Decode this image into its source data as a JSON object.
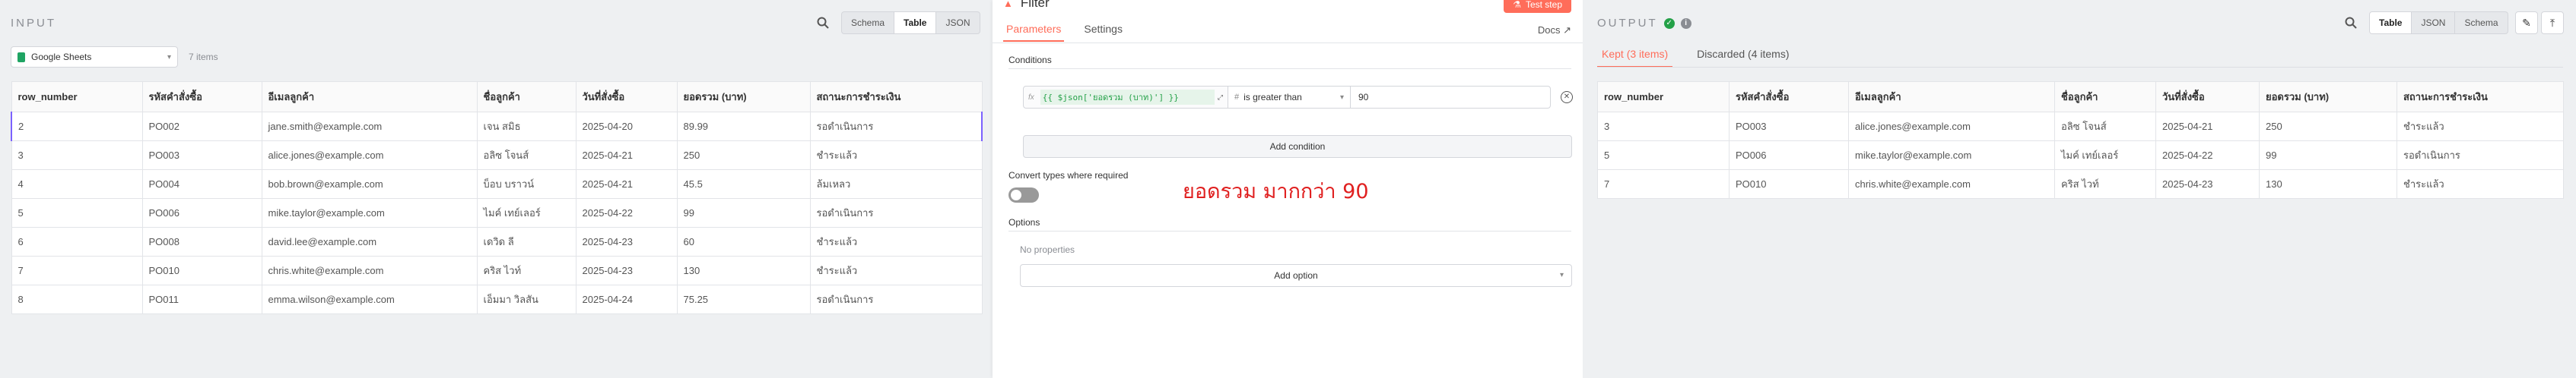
{
  "input": {
    "title": "INPUT",
    "view_options": [
      "Schema",
      "Table",
      "JSON"
    ],
    "active_view": "Table",
    "source": "Google Sheets",
    "item_count": "7 items",
    "columns": [
      "row_number",
      "รหัสคำสั่งซื้อ",
      "อีเมลลูกค้า",
      "ชื่อลูกค้า",
      "วันที่สั่งซื้อ",
      "ยอดรวม (บาท)",
      "สถานะการชำระเงิน"
    ],
    "rows": [
      [
        "2",
        "PO002",
        "jane.smith@example.com",
        "เจน สมิธ",
        "2025-04-20",
        "89.99",
        "รอดำเนินการ"
      ],
      [
        "3",
        "PO003",
        "alice.jones@example.com",
        "อลิซ โจนส์",
        "2025-04-21",
        "250",
        "ชำระแล้ว"
      ],
      [
        "4",
        "PO004",
        "bob.brown@example.com",
        "บ็อบ บราวน์",
        "2025-04-21",
        "45.5",
        "ล้มเหลว"
      ],
      [
        "5",
        "PO006",
        "mike.taylor@example.com",
        "ไมค์ เทย์เลอร์",
        "2025-04-22",
        "99",
        "รอดำเนินการ"
      ],
      [
        "6",
        "PO008",
        "david.lee@example.com",
        "เดวิด ลี",
        "2025-04-23",
        "60",
        "ชำระแล้ว"
      ],
      [
        "7",
        "PO010",
        "chris.white@example.com",
        "คริส ไวท์",
        "2025-04-23",
        "130",
        "ชำระแล้ว"
      ],
      [
        "8",
        "PO011",
        "emma.wilson@example.com",
        "เอ็มมา วิลสัน",
        "2025-04-24",
        "75.25",
        "รอดำเนินการ"
      ]
    ]
  },
  "node": {
    "title": "Filter",
    "test_step": "Test step",
    "tabs": [
      "Parameters",
      "Settings"
    ],
    "active_tab": "Parameters",
    "docs": "Docs",
    "conditions_label": "Conditions",
    "condition": {
      "left_expression": "{{ $json['ยอดรวม (บาท)'] }}",
      "operator": "is greater than",
      "value": "90"
    },
    "add_condition": "Add condition",
    "convert_label": "Convert types where required",
    "annotation": "ยอดรวม  มากกว่า   90",
    "options_label": "Options",
    "no_properties": "No properties",
    "add_option": "Add option"
  },
  "output": {
    "title": "OUTPUT",
    "view_options": [
      "Table",
      "JSON",
      "Schema"
    ],
    "active_view": "Table",
    "tabs": [
      "Kept (3 items)",
      "Discarded (4 items)"
    ],
    "active_tab": "Kept (3 items)",
    "columns": [
      "row_number",
      "รหัสคำสั่งซื้อ",
      "อีเมลลูกค้า",
      "ชื่อลูกค้า",
      "วันที่สั่งซื้อ",
      "ยอดรวม (บาท)",
      "สถานะการชำระเงิน"
    ],
    "rows": [
      [
        "3",
        "PO003",
        "alice.jones@example.com",
        "อลิซ โจนส์",
        "2025-04-21",
        "250",
        "ชำระแล้ว"
      ],
      [
        "5",
        "PO006",
        "mike.taylor@example.com",
        "ไมค์ เทย์เลอร์",
        "2025-04-22",
        "99",
        "รอดำเนินการ"
      ],
      [
        "7",
        "PO010",
        "chris.white@example.com",
        "คริส ไวท์",
        "2025-04-23",
        "130",
        "ชำระแล้ว"
      ]
    ]
  },
  "colors": {
    "accent": "#ff6d5a",
    "success": "#24a148",
    "selection": "#7b61ff",
    "annotation": "#e02020"
  }
}
